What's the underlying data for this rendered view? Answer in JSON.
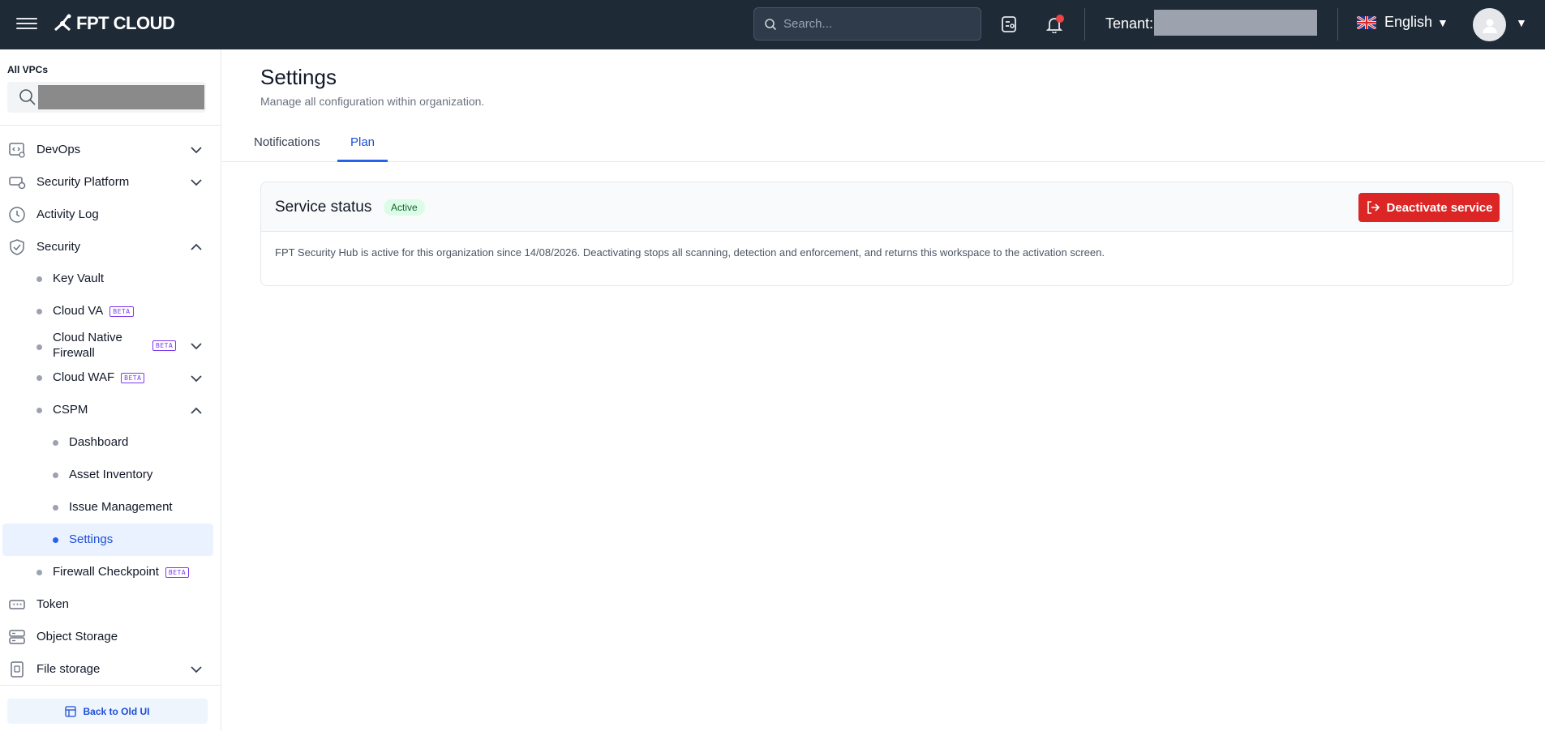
{
  "brand": {
    "name": "FPT CLOUD"
  },
  "header": {
    "search_placeholder": "Search...",
    "tenant_label": "Tenant:",
    "language": "English"
  },
  "sidebar": {
    "vpc_label": "All VPCs",
    "items": [
      {
        "label": "DevOps",
        "icon": "devops-icon",
        "expandable": true,
        "expanded": false
      },
      {
        "label": "Security Platform",
        "icon": "security-platform-icon",
        "expandable": true,
        "expanded": false
      },
      {
        "label": "Activity Log",
        "icon": "clock-icon",
        "expandable": false
      },
      {
        "label": "Security",
        "icon": "shield-icon",
        "expandable": true,
        "expanded": true
      }
    ],
    "security_children": [
      {
        "label": "Key Vault",
        "beta": false
      },
      {
        "label": "Cloud VA",
        "beta": true
      },
      {
        "label": "Cloud Native",
        "label2": "Firewall",
        "beta": true,
        "expandable": true
      },
      {
        "label": "Cloud WAF",
        "beta": true,
        "expandable": true
      },
      {
        "label": "CSPM",
        "beta": false,
        "expandable": true,
        "expanded": true
      }
    ],
    "cspm_children": [
      {
        "label": "Dashboard"
      },
      {
        "label": "Asset Inventory"
      },
      {
        "label": "Issue Management"
      },
      {
        "label": "Settings",
        "active": true
      }
    ],
    "after_cspm": {
      "label": "Firewall Checkpoint",
      "beta": true
    },
    "bottom_items": [
      {
        "label": "Token",
        "icon": "token-icon"
      },
      {
        "label": "Object Storage",
        "icon": "storage-icon"
      },
      {
        "label": "File storage",
        "icon": "file-storage-icon",
        "expandable": true
      }
    ],
    "beta_label": "BETA",
    "back_label": "Back to Old UI"
  },
  "main": {
    "title": "Settings",
    "subtitle": "Manage all configuration within organization.",
    "tabs": [
      {
        "label": "Notifications",
        "active": false
      },
      {
        "label": "Plan",
        "active": true
      }
    ],
    "card": {
      "title": "Service status",
      "badge": "Active",
      "button": "Deactivate service",
      "description": "FPT Security Hub is active for this organization since 14/08/2026. Deactivating stops all scanning, detection and enforcement, and returns this workspace to the activation screen."
    }
  },
  "colors": {
    "topbar": "#1f2a37",
    "accent": "#2563eb",
    "danger": "#dc2626",
    "success_bg": "#dcfce7"
  }
}
